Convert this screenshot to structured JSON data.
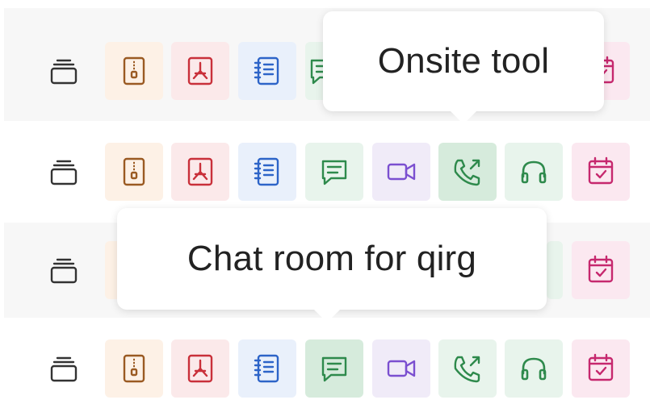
{
  "tooltips": {
    "call": "Onsite tool",
    "chat": "Chat room for qirg"
  },
  "icons": [
    "stack-icon",
    "zip-file-icon",
    "pdf-file-icon",
    "notes-icon",
    "chat-icon",
    "video-icon",
    "phone-call-icon",
    "headphones-icon",
    "calendar-icon"
  ],
  "colors": {
    "zip": "#9a5a22",
    "pdf": "#c9303a",
    "notes": "#2d64c8",
    "chat": "#2e8a4c",
    "video": "#7b4fd0",
    "call": "#2e8a4c",
    "audio": "#2e8a4c",
    "calendar": "#c6286e",
    "stack": "#333333"
  }
}
